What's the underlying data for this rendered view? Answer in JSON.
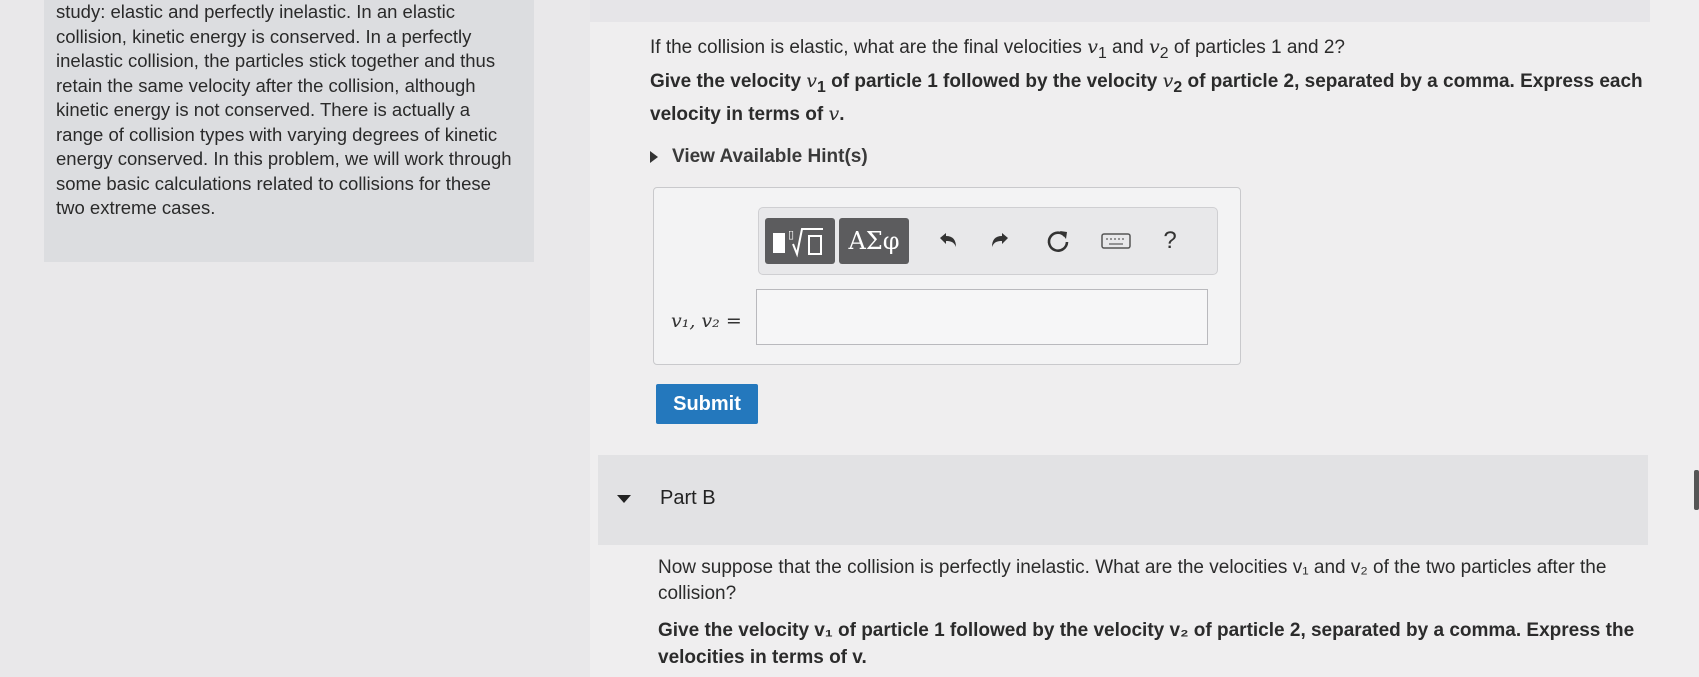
{
  "intro": {
    "text": "study: elastic and perfectly inelastic. In an elastic collision, kinetic energy is conserved. In a perfectly inelastic collision, the particles stick together and thus retain the same velocity after the collision, although kinetic energy is not conserved. There is actually a range of collision types with varying degrees of kinetic energy conserved. In this problem, we will work through some basic calculations related to collisions for these two extreme cases."
  },
  "part_a": {
    "question_pre": "If the collision is elastic, what are the final velocities ",
    "v1": "v",
    "sub1": "1",
    "and": " and ",
    "v2": "v",
    "sub2": "2",
    "question_post": " of particles 1 and 2?",
    "instr_1": "Give the velocity ",
    "instr_2": " of particle 1 followed by the velocity ",
    "instr_3": " of particle 2, separated by a comma. Express each velocity in terms of ",
    "instr_v": "v",
    "instr_end": ".",
    "hint_label": "View Available Hint(s)",
    "toolbar": {
      "greek_label": "ΑΣφ",
      "help_label": "?"
    },
    "answer_label": "v₁, v₂ =",
    "answer_value": "",
    "submit_label": "Submit"
  },
  "part_b": {
    "label": "Part B",
    "question": "Now suppose that the collision is perfectly inelastic. What are the velocities v₁ and v₂ of the two particles after the collision?",
    "instructions": "Give the velocity v₁ of particle 1 followed by the velocity v₂ of particle 2, separated by a comma. Express the velocities in terms of v."
  },
  "icons": [
    "templates-icon",
    "undo-icon",
    "redo-icon",
    "reset-icon",
    "keyboard-icon",
    "help-icon",
    "caret-right-icon",
    "caret-down-icon"
  ]
}
